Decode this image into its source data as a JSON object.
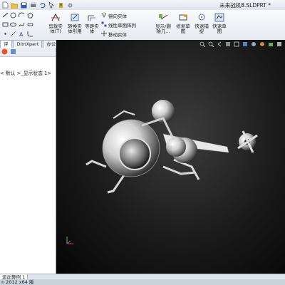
{
  "window": {
    "title": "未来战机8.SLDPRT *"
  },
  "ribbon": {
    "cut_feature": "剪裁实\n体(T)",
    "convert_entities": "转换实\n体引用",
    "equidistant_entities": "等距实\n体",
    "mirror_entities": "镜向实体",
    "linear_pattern": "线性草图阵列",
    "move_entities": "移动实体",
    "show_hide_relations": "显示/删\n除几...",
    "repair_sketch": "修复草\n图",
    "quick_snap": "快速捕\n捉",
    "quick_sketch": "快速草\n图"
  },
  "tabs": [
    {
      "label": "评估"
    },
    {
      "label": "DimXpert"
    },
    {
      "label": "办公室产品"
    }
  ],
  "left_panel": {
    "config_text": "< 默认 >_显示状态 1>"
  },
  "bottom_tab": {
    "label": "运动算例 1"
  },
  "status_bar": {
    "text": "n 2012 x64 版"
  },
  "colors": {
    "accent": "#2a5d9f",
    "viewport_bg": "#1a1a1a"
  }
}
